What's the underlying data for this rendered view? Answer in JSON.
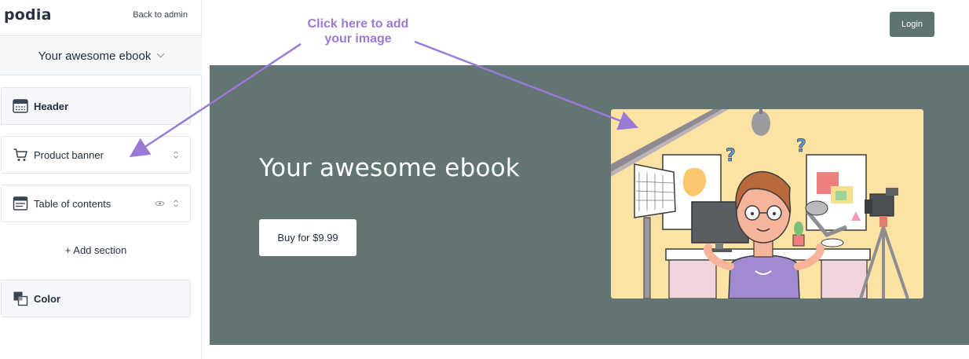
{
  "sidebar": {
    "logo": "podia",
    "back_link": "Back to admin",
    "page_selector": {
      "label": "Your awesome ebook",
      "icon": "chevron-down-icon"
    },
    "sections": [
      {
        "label": "Header",
        "icon": "header-layout-icon",
        "style": "bold"
      },
      {
        "label": "Product banner",
        "icon": "cart-icon",
        "controls": [
          "sort-handle-icon"
        ]
      },
      {
        "label": "Table of contents",
        "icon": "table-of-contents-icon",
        "controls": [
          "eye-icon",
          "sort-handle-icon"
        ]
      }
    ],
    "add_section": "+ Add section",
    "color_section": {
      "label": "Color",
      "icon": "color-swatch-icon"
    }
  },
  "preview": {
    "login": "Login",
    "product_title": "Your awesome ebook",
    "buy_button": "Buy for $9.99",
    "banner_color": "#627574",
    "image_alt": "Illustration of a person at a desk with a monitor, studio light and camera"
  },
  "annotation": {
    "text": "Click here to add your image",
    "color": "#9b79d6"
  }
}
